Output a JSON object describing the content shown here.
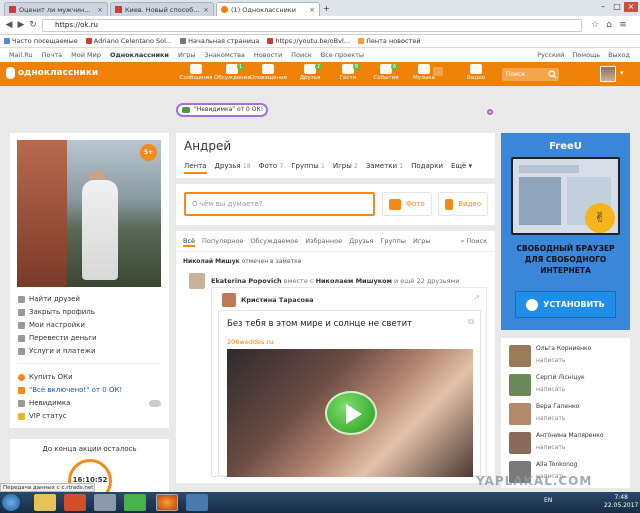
{
  "browser": {
    "tabs": [
      {
        "label": "Оценит ли мужчина мо"
      },
      {
        "label": "Киев. Новый способ зараб"
      },
      {
        "label": "(1) Одноклассники"
      }
    ],
    "url": "https://ok.ru",
    "bookmarks": [
      "Часто посещаемые",
      "Adriano Celentano Sol...",
      "Начальная страница",
      "https://youtu.be/oBvl...",
      "Лента новостей"
    ]
  },
  "ok": {
    "toplinks": [
      "Mail.Ru",
      "Почта",
      "Мой Мир",
      "Одноклассники",
      "Игры",
      "Знакомства",
      "Новости",
      "Поиск",
      "Все проекты"
    ],
    "topright": [
      "Русский",
      "Помощь",
      "Выход"
    ],
    "logo": "одноклассники",
    "nav": [
      {
        "label": "Сообщения",
        "badge": ""
      },
      {
        "label": "Обсуждения",
        "badge": "1"
      },
      {
        "label": "Оповещения",
        "badge": ""
      },
      {
        "label": "Друзья",
        "badge": "2"
      },
      {
        "label": "Гости",
        "badge": "8"
      },
      {
        "label": "События",
        "badge": "6"
      },
      {
        "label": "Музыка",
        "badge": ""
      },
      {
        "label": "Видео",
        "badge": ""
      }
    ],
    "search_placeholder": "Поиск",
    "invisible_pill": "\"Невидимка\" от 0 ОК!"
  },
  "profile": {
    "name": "Андрей",
    "age_badge": "5+",
    "tabs": [
      {
        "label": "Лента",
        "n": ""
      },
      {
        "label": "Друзья",
        "n": "18"
      },
      {
        "label": "Фото",
        "n": "7"
      },
      {
        "label": "Группы",
        "n": "1"
      },
      {
        "label": "Игры",
        "n": "2"
      },
      {
        "label": "Заметки",
        "n": "1"
      },
      {
        "label": "Подарки",
        "n": ""
      },
      {
        "label": "Ещё ▾",
        "n": ""
      }
    ],
    "menu": [
      "Найти друзей",
      "Закрыть профиль",
      "Мои настройки",
      "Перевести деньги",
      "Услуги и платежи"
    ],
    "menu2": [
      "Купить ОКи",
      "\"Всё включено!\" от 0 ОК!",
      "Невидимка",
      "VIP статус"
    ],
    "promo_title": "До конца акции осталось",
    "promo_timer": "16:10:52"
  },
  "post": {
    "placeholder": "О чём вы думаете?",
    "photo": "Фото",
    "video": "Видео"
  },
  "feed": {
    "tabs": [
      "Всё",
      "Популярное",
      "Обсуждаемое",
      "Избранное",
      "Друзья",
      "Группы",
      "Игры"
    ],
    "search": "Поиск",
    "header_name": "Николай Мишук",
    "header_text": "отмечен в заметке",
    "story_author": "Ekaterina Popovich",
    "story_with": "вместе с",
    "story_friend": "Николаем Мишуком",
    "story_more": "и ещё 22 друзьями",
    "inner_author": "Кристина Тарасова",
    "article_title": "Без тебя в этом мире и солнце не светит",
    "article_link": "206weddes.ru"
  },
  "ad": {
    "title": "FreeU",
    "text": "СВОБОДНЫЙ БРАУЗЕР ДЛЯ СВОБОДНОГО ИНТЕРНЕТА",
    "button": "УСТАНОВИТЬ"
  },
  "friends": [
    {
      "name": "Ольга Корниенко",
      "action": "написать"
    },
    {
      "name": "Сергій Лісніцук",
      "action": "написать"
    },
    {
      "name": "Вера Галенко",
      "action": "написать"
    },
    {
      "name": "Антонина Маляренко",
      "action": "написать"
    },
    {
      "name": "Alla Tonkonog",
      "action": "написать"
    }
  ],
  "status_text": "Передача данных с c.rtrads.net...",
  "watermark": "YAPLAKAL.COM",
  "taskbar": {
    "lang": "EN",
    "time": "7:48",
    "date": "22.05.2017"
  },
  "colors": {
    "ok_orange": "#ee8208",
    "ad_blue": "#3a86d8",
    "play_green": "#3cb52e"
  }
}
